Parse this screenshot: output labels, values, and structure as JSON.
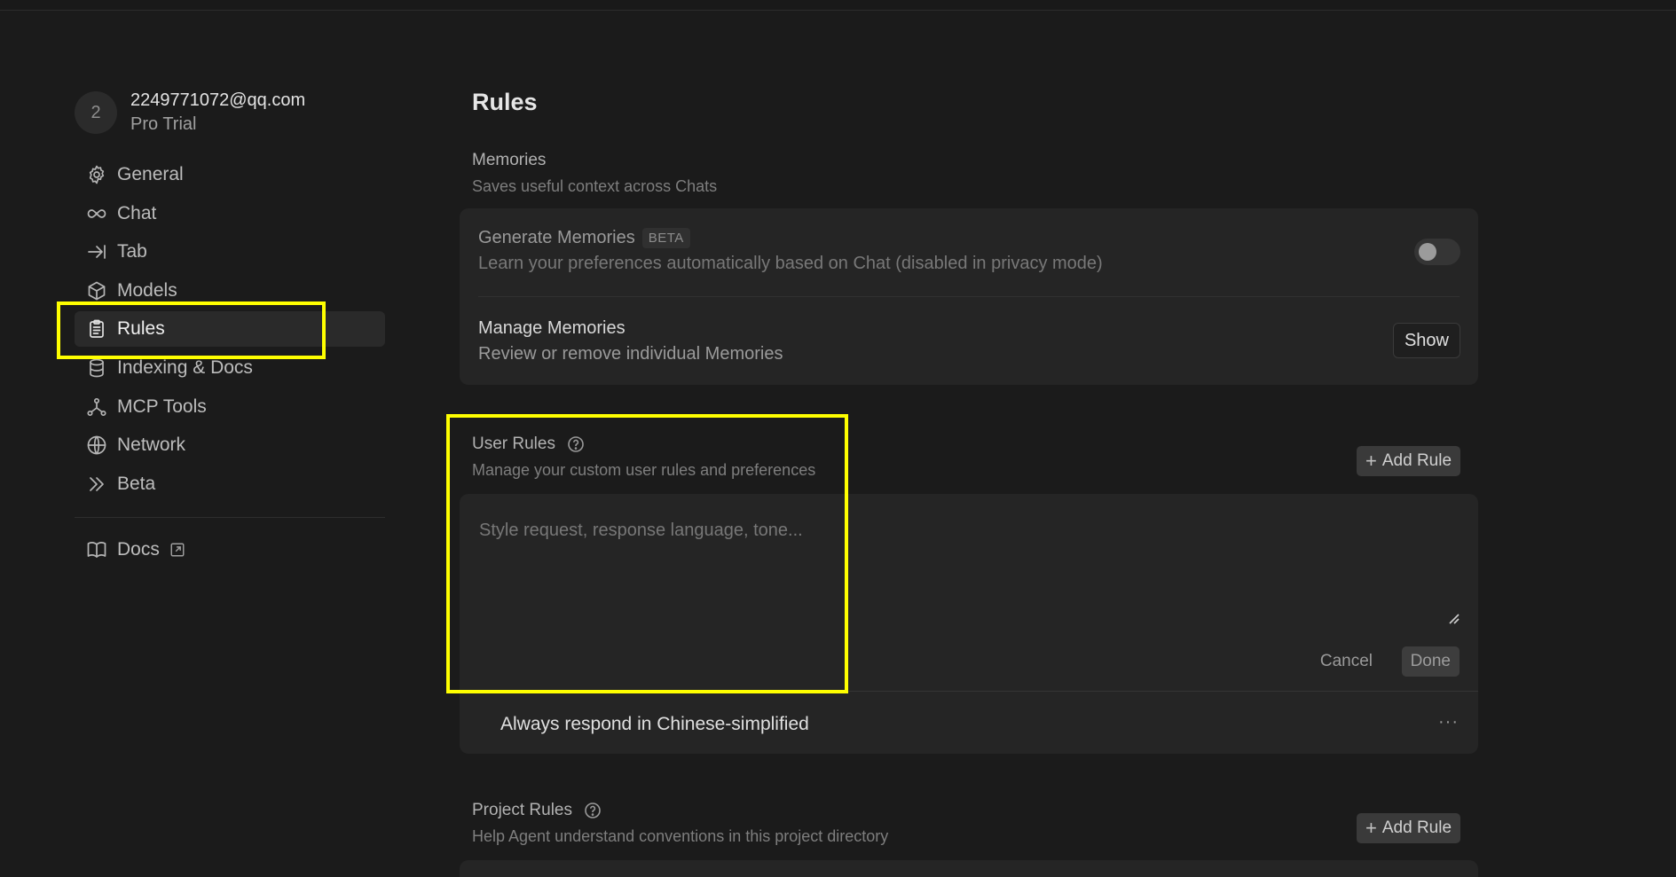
{
  "account": {
    "avatar_initial": "2",
    "email": "2249771072@qq.com",
    "plan": "Pro Trial"
  },
  "sidebar": {
    "items": [
      {
        "label": "General",
        "icon": "gear-icon"
      },
      {
        "label": "Chat",
        "icon": "infinity-icon"
      },
      {
        "label": "Tab",
        "icon": "arrow-right-bar-icon"
      },
      {
        "label": "Models",
        "icon": "cube-icon"
      },
      {
        "label": "Rules",
        "icon": "clipboard-icon",
        "active": true
      },
      {
        "label": "Indexing & Docs",
        "icon": "database-icon"
      },
      {
        "label": "MCP Tools",
        "icon": "nodes-icon"
      },
      {
        "label": "Network",
        "icon": "globe-icon"
      },
      {
        "label": "Beta",
        "icon": "double-chevron-icon"
      }
    ],
    "docs_label": "Docs"
  },
  "page": {
    "title": "Rules"
  },
  "memories": {
    "title": "Memories",
    "subtitle": "Saves useful context across Chats",
    "generate": {
      "title": "Generate Memories",
      "badge": "BETA",
      "subtitle": "Learn your preferences automatically based on Chat (disabled in privacy mode)",
      "enabled": false
    },
    "manage": {
      "title": "Manage Memories",
      "subtitle": "Review or remove individual Memories",
      "button": "Show"
    }
  },
  "user_rules": {
    "title": "User Rules",
    "subtitle": "Manage your custom user rules and preferences",
    "add_button": "Add Rule",
    "placeholder": "Style request, response language, tone...",
    "cancel": "Cancel",
    "done": "Done",
    "rules": [
      "Always respond in Chinese-simplified"
    ],
    "more": "···"
  },
  "project_rules": {
    "title": "Project Rules",
    "subtitle": "Help Agent understand conventions in this project directory",
    "add_button": "Add Rule"
  },
  "colors": {
    "highlight": "#ffff00",
    "background": "#1b1b1b",
    "card": "#252525"
  }
}
